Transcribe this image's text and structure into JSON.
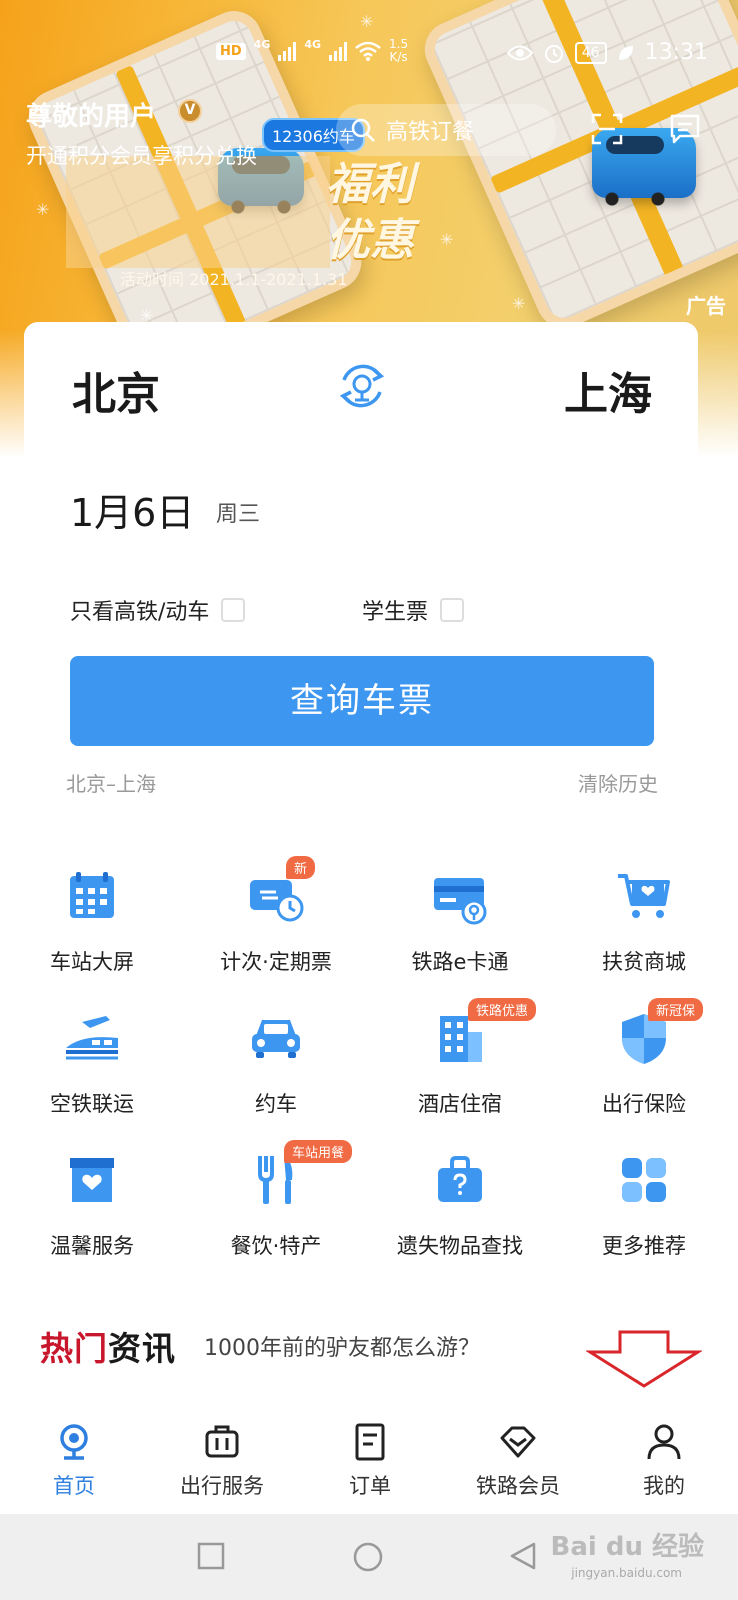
{
  "status_bar": {
    "hd": "HD",
    "net1": "4G",
    "net2": "4G",
    "speed_value": "1.5",
    "speed_unit": "K/s",
    "battery": "46",
    "time": "13:31"
  },
  "banner": {
    "user_name": "尊敬的用户",
    "vip_letter": "V",
    "user_subtitle": "开通积分会员享积分兑换",
    "pill_label": "12306约车",
    "search_placeholder": "高铁订餐",
    "promo_line1": "福利",
    "promo_line2": "优惠",
    "activity_time": "活动时间 2021.1.1-2021.1.31",
    "ad_label": "广告"
  },
  "booking": {
    "from_city": "北京",
    "to_city": "上海",
    "date": "1月6日",
    "weekday": "周三",
    "option_highspeed": "只看高铁/动车",
    "option_student": "学生票",
    "query_button": "查询车票",
    "history_route": "北京–上海",
    "clear_history": "清除历史"
  },
  "services": [
    {
      "label": "车站大屏",
      "icon": "calendar-grid-icon",
      "tag": ""
    },
    {
      "label": "计次·定期票",
      "icon": "ticket-clock-icon",
      "tag": "新"
    },
    {
      "label": "铁路e卡通",
      "icon": "rail-card-icon",
      "tag": ""
    },
    {
      "label": "扶贫商城",
      "icon": "shopping-cart-icon",
      "tag": ""
    },
    {
      "label": "空铁联运",
      "icon": "plane-train-icon",
      "tag": ""
    },
    {
      "label": "约车",
      "icon": "car-icon",
      "tag": ""
    },
    {
      "label": "酒店住宿",
      "icon": "hotel-building-icon",
      "tag": "铁路优惠"
    },
    {
      "label": "出行保险",
      "icon": "shield-icon",
      "tag": "新冠保"
    },
    {
      "label": "温馨服务",
      "icon": "heart-box-icon",
      "tag": ""
    },
    {
      "label": "餐饮·特产",
      "icon": "fork-knife-icon",
      "tag": "车站用餐"
    },
    {
      "label": "遗失物品查找",
      "icon": "lost-bag-icon",
      "tag": ""
    },
    {
      "label": "更多推荐",
      "icon": "more-apps-icon",
      "tag": ""
    }
  ],
  "news": {
    "title_red": "热门",
    "title_rest": "资讯",
    "headline": "1000年前的驴友都怎么游？"
  },
  "tabs": [
    {
      "label": "首页",
      "icon": "home-rail-icon",
      "active": true
    },
    {
      "label": "出行服务",
      "icon": "luggage-icon",
      "active": false
    },
    {
      "label": "订单",
      "icon": "order-list-icon",
      "active": false
    },
    {
      "label": "铁路会员",
      "icon": "diamond-icon",
      "active": false
    },
    {
      "label": "我的",
      "icon": "person-icon",
      "active": false
    }
  ],
  "watermark": {
    "main": "Bai du 经验",
    "sub": "jingyan.baidu.com"
  },
  "colors": {
    "accent": "#3d97f0",
    "tab_active": "#2f7fe0",
    "tag": "#f06a43",
    "news_red": "#c8172c",
    "annotation_arrow": "#d9262b"
  }
}
